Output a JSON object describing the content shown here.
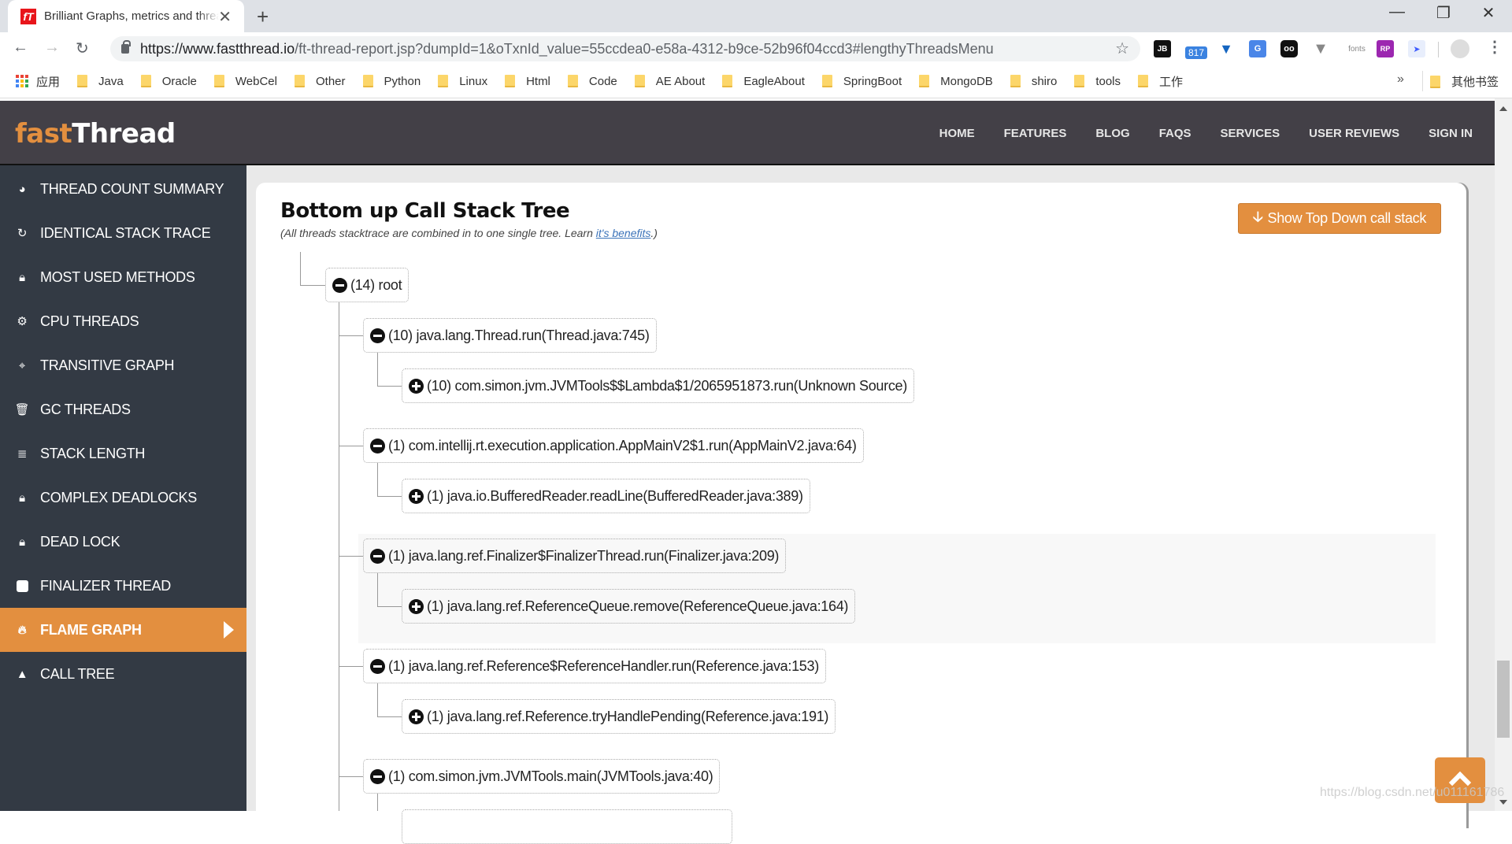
{
  "browser": {
    "tab_title": "Brilliant Graphs, metrics and thread dump analysis",
    "favicon_text": "fT",
    "url_host": "https://www.fastthread.io",
    "url_path": "/ft-thread-report.jsp?dumpId=1&oTxnId_value=55ccdea0-e58a-4312-b9ce-52b96f04ccd3#lengthyThreadsMenu",
    "extensions": [
      "JB",
      "817",
      "V",
      "G",
      "oo",
      "V",
      "fonts",
      "RP",
      "bird"
    ],
    "extension_badge": "817",
    "bookmarks_apps_label": "应用",
    "bookmarks": [
      "Java",
      "Oracle",
      "WebCel",
      "Other",
      "Python",
      "Linux",
      "Html",
      "Code",
      "AE About",
      "EagleAbout",
      "SpringBoot",
      "MongoDB",
      "shiro",
      "tools",
      "工作"
    ],
    "bookmarks_more": "»",
    "other_bookmarks": "其他书签"
  },
  "site": {
    "logo_fast": "fast",
    "logo_thread": "Thread",
    "nav": [
      "HOME",
      "FEATURES",
      "BLOG",
      "FAQS",
      "SERVICES",
      "USER REVIEWS",
      "SIGN IN"
    ],
    "accent_color": "#e38f3f"
  },
  "sidebar": {
    "items": [
      {
        "label": "THREAD COUNT SUMMARY",
        "icon": "dashboard-icon",
        "active": false
      },
      {
        "label": "IDENTICAL STACK TRACE",
        "icon": "refresh-icon",
        "active": false
      },
      {
        "label": "MOST USED METHODS",
        "icon": "lock-icon",
        "active": false
      },
      {
        "label": "CPU THREADS",
        "icon": "gears-icon",
        "active": false
      },
      {
        "label": "TRANSITIVE GRAPH",
        "icon": "crosshairs-icon",
        "active": false
      },
      {
        "label": "GC THREADS",
        "icon": "trash-icon",
        "active": false
      },
      {
        "label": "STACK LENGTH",
        "icon": "stack-icon",
        "active": false
      },
      {
        "label": "COMPLEX DEADLOCKS",
        "icon": "lock-icon",
        "active": false
      },
      {
        "label": "DEAD LOCK",
        "icon": "lock-icon",
        "active": false
      },
      {
        "label": "FINALIZER THREAD",
        "icon": "square-icon",
        "active": false
      },
      {
        "label": "FLAME GRAPH",
        "icon": "fire-icon",
        "active": true
      },
      {
        "label": "CALL TREE",
        "icon": "tree-icon",
        "active": false
      }
    ]
  },
  "main": {
    "title": "Bottom up Call Stack Tree",
    "subtitle_prefix": "(All threads stacktrace are combined in to one single tree. Learn ",
    "subtitle_link": "it's benefits",
    "subtitle_suffix": ".)",
    "top_down_button": "Show Top Down call stack",
    "tree": [
      {
        "count": 14,
        "label": "(14) root",
        "level": 0,
        "expanded": true
      },
      {
        "count": 10,
        "label": "(10) java.lang.Thread.run(Thread.java:745)",
        "level": 1,
        "expanded": true
      },
      {
        "count": 10,
        "label": "(10) com.simon.jvm.JVMTools$$Lambda$1/2065951873.run(Unknown Source)",
        "level": 2,
        "expanded": false
      },
      {
        "count": 1,
        "label": "(1) com.intellij.rt.execution.application.AppMainV2$1.run(AppMainV2.java:64)",
        "level": 1,
        "expanded": true
      },
      {
        "count": 1,
        "label": "(1) java.io.BufferedReader.readLine(BufferedReader.java:389)",
        "level": 2,
        "expanded": false
      },
      {
        "count": 1,
        "label": "(1) java.lang.ref.Finalizer$FinalizerThread.run(Finalizer.java:209)",
        "level": 1,
        "expanded": true
      },
      {
        "count": 1,
        "label": "(1) java.lang.ref.ReferenceQueue.remove(ReferenceQueue.java:164)",
        "level": 2,
        "expanded": false
      },
      {
        "count": 1,
        "label": "(1) java.lang.ref.Reference$ReferenceHandler.run(Reference.java:153)",
        "level": 1,
        "expanded": true
      },
      {
        "count": 1,
        "label": "(1) java.lang.ref.Reference.tryHandlePending(Reference.java:191)",
        "level": 2,
        "expanded": false
      },
      {
        "count": 1,
        "label": "(1) com.simon.jvm.JVMTools.main(JVMTools.java:40)",
        "level": 1,
        "expanded": true
      }
    ]
  },
  "watermark": "https://blog.csdn.net/u011161786"
}
